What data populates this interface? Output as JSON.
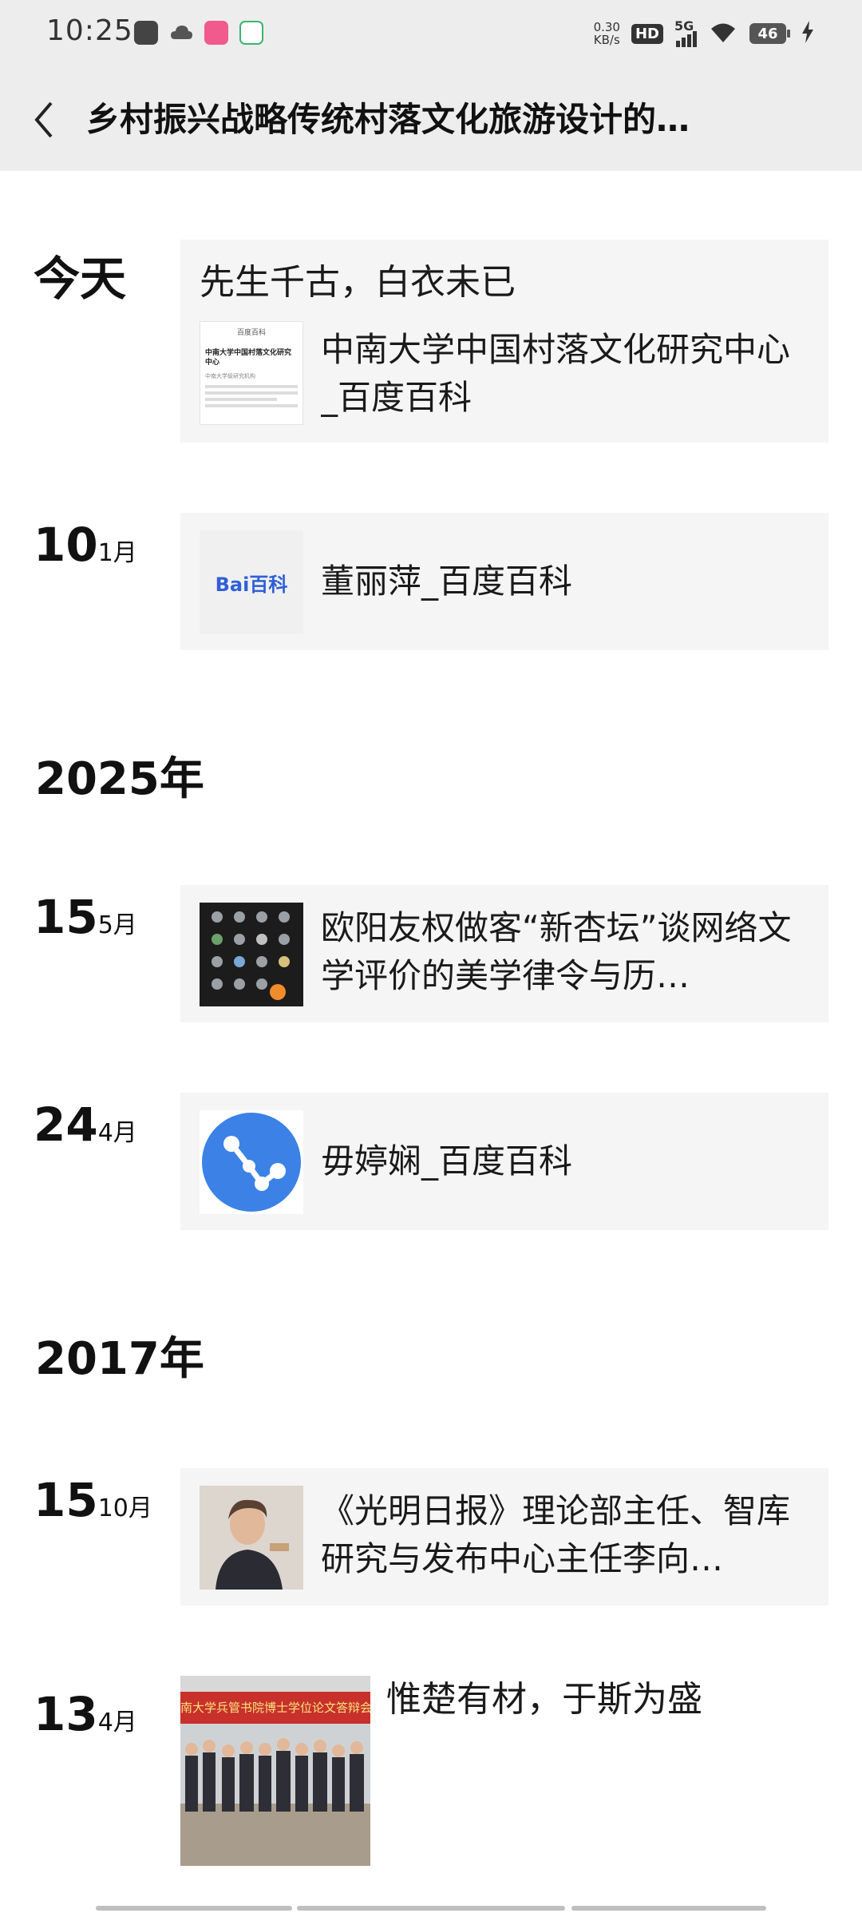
{
  "status_bar": {
    "time": "10:25",
    "net_speed_value": "0.30",
    "net_speed_unit": "KB/s",
    "hd": "HD",
    "signal": "5G",
    "battery": "46"
  },
  "header": {
    "title": "乡村振兴战略传统村落文化旅游设计的…"
  },
  "timeline": {
    "today_label": "今天",
    "entry_today": {
      "title": "先生千古，白衣未已",
      "link_text": "中南大学中国村落文化研究中心_百度百科",
      "thumb": {
        "app_name": "百度百科",
        "heading": "中南大学中国村落文化研究中心",
        "subheading": "中南大学级研究机构"
      }
    },
    "entry_10": {
      "day": "10",
      "month": "1月",
      "text": "董丽萍_百度百科",
      "logo_text": "Bai百科"
    },
    "year_2025": "2025年",
    "entry_15_5": {
      "day": "15",
      "month": "5月",
      "text": "欧阳友权做客“新杏坛”谈网络文学评价的美学律令与历…"
    },
    "entry_24": {
      "day": "24",
      "month": "4月",
      "text": "毋婷娴_百度百科"
    },
    "year_2017": "2017年",
    "entry_15_10": {
      "day": "15",
      "month": "10月",
      "text": "《光明日报》理论部主任、智库研究与发布中心主任李向…"
    },
    "entry_13": {
      "day": "13",
      "month": "4月",
      "text": "惟楚有材，于斯为盛",
      "banner_text": "南大学兵管书院博士学位论文答辩会"
    }
  }
}
